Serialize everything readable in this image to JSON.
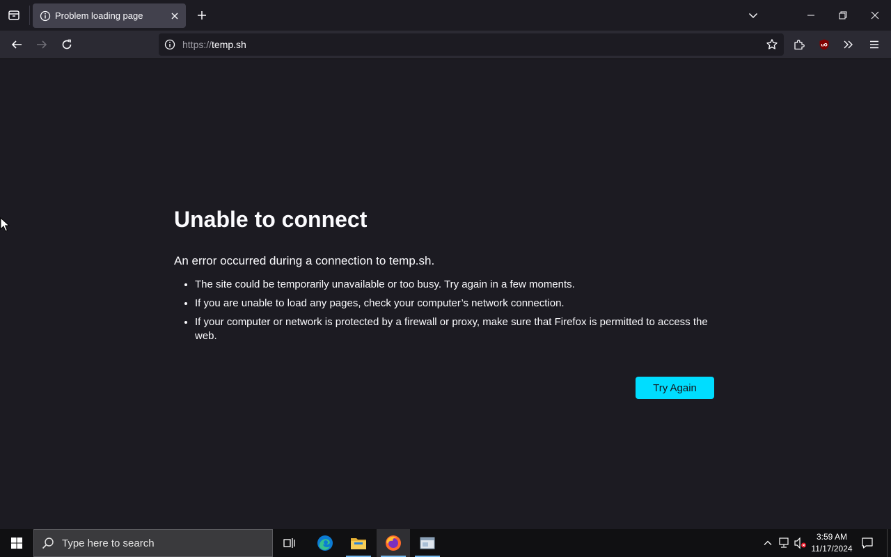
{
  "browser": {
    "active_tab": {
      "title": "Problem loading page"
    },
    "urlbar": {
      "scheme": "https://",
      "host": "temp.sh"
    },
    "extensions": {
      "ublock_badge": "uO"
    }
  },
  "error_page": {
    "title": "Unable to connect",
    "description": "An error occurred during a connection to temp.sh.",
    "suggestions": [
      "The site could be temporarily unavailable or too busy. Try again in a few moments.",
      "If you are unable to load any pages, check your computer’s network connection.",
      "If your computer or network is protected by a firewall or proxy, make sure that Firefox is permitted to access the web."
    ],
    "try_again_label": "Try Again"
  },
  "taskbar": {
    "search_placeholder": "Type here to search",
    "clock": {
      "time": "3:59 AM",
      "date": "11/17/2024"
    }
  },
  "colors": {
    "accent": "#00ddff",
    "page_bg": "#1c1b22",
    "toolbar_bg": "#2b2a33",
    "tab_active_bg": "#42414d"
  }
}
